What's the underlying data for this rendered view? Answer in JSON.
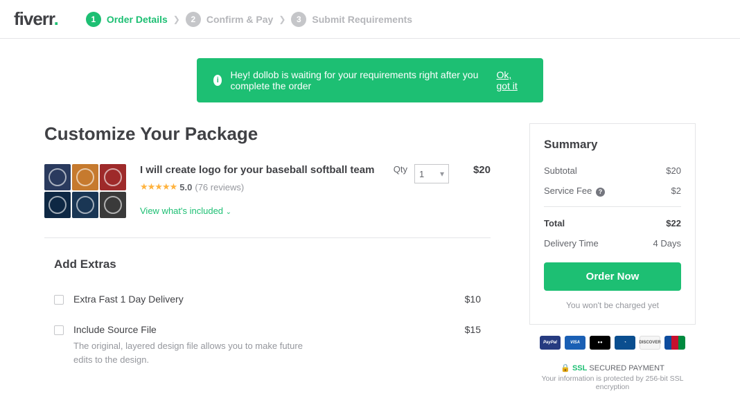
{
  "logo": "fiverr",
  "steps": [
    {
      "num": "1",
      "label": "Order Details"
    },
    {
      "num": "2",
      "label": "Confirm & Pay"
    },
    {
      "num": "3",
      "label": "Submit Requirements"
    }
  ],
  "banner": {
    "text": "Hey! dollob is waiting for your requirements right after you complete the order",
    "action": "Ok, got it"
  },
  "page_title": "Customize Your Package",
  "gig": {
    "title": "I will create logo for your baseball softball team",
    "rating": "5.0",
    "reviews": "(76 reviews)",
    "included_link": "View what's included",
    "qty_label": "Qty",
    "qty_value": "1",
    "price": "$20"
  },
  "extras_title": "Add Extras",
  "extras": [
    {
      "name": "Extra Fast 1 Day Delivery",
      "desc": "",
      "price": "$10"
    },
    {
      "name": "Include Source File",
      "desc": "The original, layered design file allows you to make future edits to the design.",
      "price": "$15"
    }
  ],
  "summary": {
    "title": "Summary",
    "subtotal_label": "Subtotal",
    "subtotal": "$20",
    "fee_label": "Service Fee",
    "fee": "$2",
    "total_label": "Total",
    "total": "$22",
    "delivery_label": "Delivery Time",
    "delivery": "4 Days",
    "button": "Order Now",
    "note": "You won't be charged yet"
  },
  "ssl": {
    "label": "SSL",
    "text": "SECURED PAYMENT",
    "sub": "Your information is protected by 256-bit SSL encryption"
  }
}
